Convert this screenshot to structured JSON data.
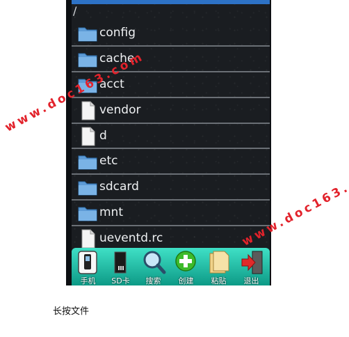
{
  "path": "/",
  "files": [
    {
      "name": "config",
      "type": "folder"
    },
    {
      "name": "cache",
      "type": "folder"
    },
    {
      "name": "acct",
      "type": "folder"
    },
    {
      "name": "vendor",
      "type": "file"
    },
    {
      "name": "d",
      "type": "file"
    },
    {
      "name": "etc",
      "type": "folder"
    },
    {
      "name": "sdcard",
      "type": "folder"
    },
    {
      "name": "mnt",
      "type": "folder"
    },
    {
      "name": "ueventd.rc",
      "type": "file"
    }
  ],
  "toolbar": {
    "phone": "手机",
    "sdcard": "SD卡",
    "search": "搜索",
    "create": "创建",
    "paste": "粘贴",
    "exit": "退出"
  },
  "watermarks": [
    "www.doc163.com",
    "www.doc163.com"
  ],
  "caption": "长按文件",
  "colors": {
    "accent": "#2d72c6",
    "toolbar": "#1fbfa8",
    "watermark": "#e2222b"
  }
}
